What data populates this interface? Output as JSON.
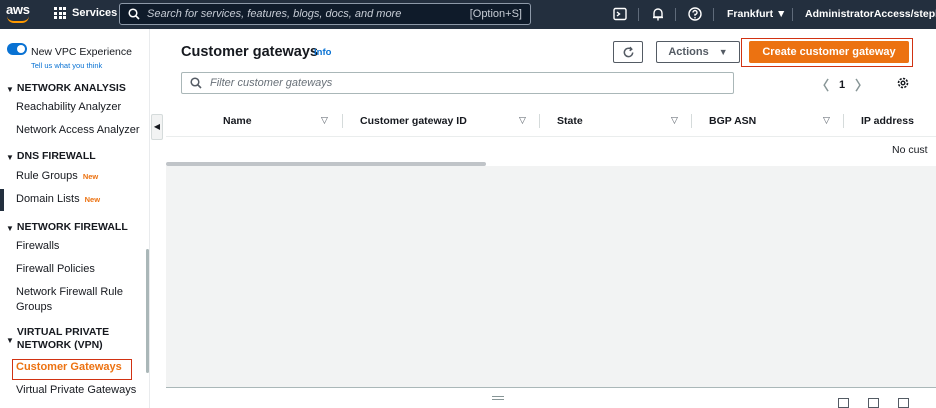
{
  "topnav": {
    "logo": "aws",
    "services_label": "Services",
    "search_placeholder": "Search for services, features, blogs, docs, and more",
    "search_shortcut": "[Option+S]",
    "region": "Frankfurt",
    "account": "AdministratorAccess/stephane",
    "icons": [
      "cloudshell-icon",
      "bell-icon",
      "help-icon"
    ]
  },
  "sidebar": {
    "vpc_experience": "New VPC Experience",
    "feedback_link": "Tell us what you think",
    "sections": [
      {
        "title": "NETWORK ANALYSIS",
        "items": [
          "Reachability Analyzer",
          "Network Access Analyzer"
        ]
      },
      {
        "title": "DNS FIREWALL",
        "items": [
          "Rule Groups",
          "Domain Lists"
        ]
      },
      {
        "title": "NETWORK FIREWALL",
        "items": [
          "Firewalls",
          "Firewall Policies",
          "Network Firewall Rule Groups"
        ]
      },
      {
        "title": "VIRTUAL PRIVATE NETWORK (VPN)",
        "items": [
          "Customer Gateways",
          "Virtual Private Gateways"
        ]
      }
    ],
    "new_badge": "New",
    "active_item": "Customer Gateways"
  },
  "main": {
    "title": "Customer gateways",
    "info": "Info",
    "actions_label": "Actions",
    "create_label": "Create customer gateway",
    "filter_placeholder": "Filter customer gateways",
    "page": "1",
    "columns": [
      "Name",
      "Customer gateway ID",
      "State",
      "BGP ASN",
      "IP address"
    ],
    "empty_text": "No cust"
  },
  "colors": {
    "nav_bg": "#232f3e",
    "accent_orange": "#ec7211",
    "link_blue": "#0972d3",
    "highlight_red": "#d13212"
  }
}
